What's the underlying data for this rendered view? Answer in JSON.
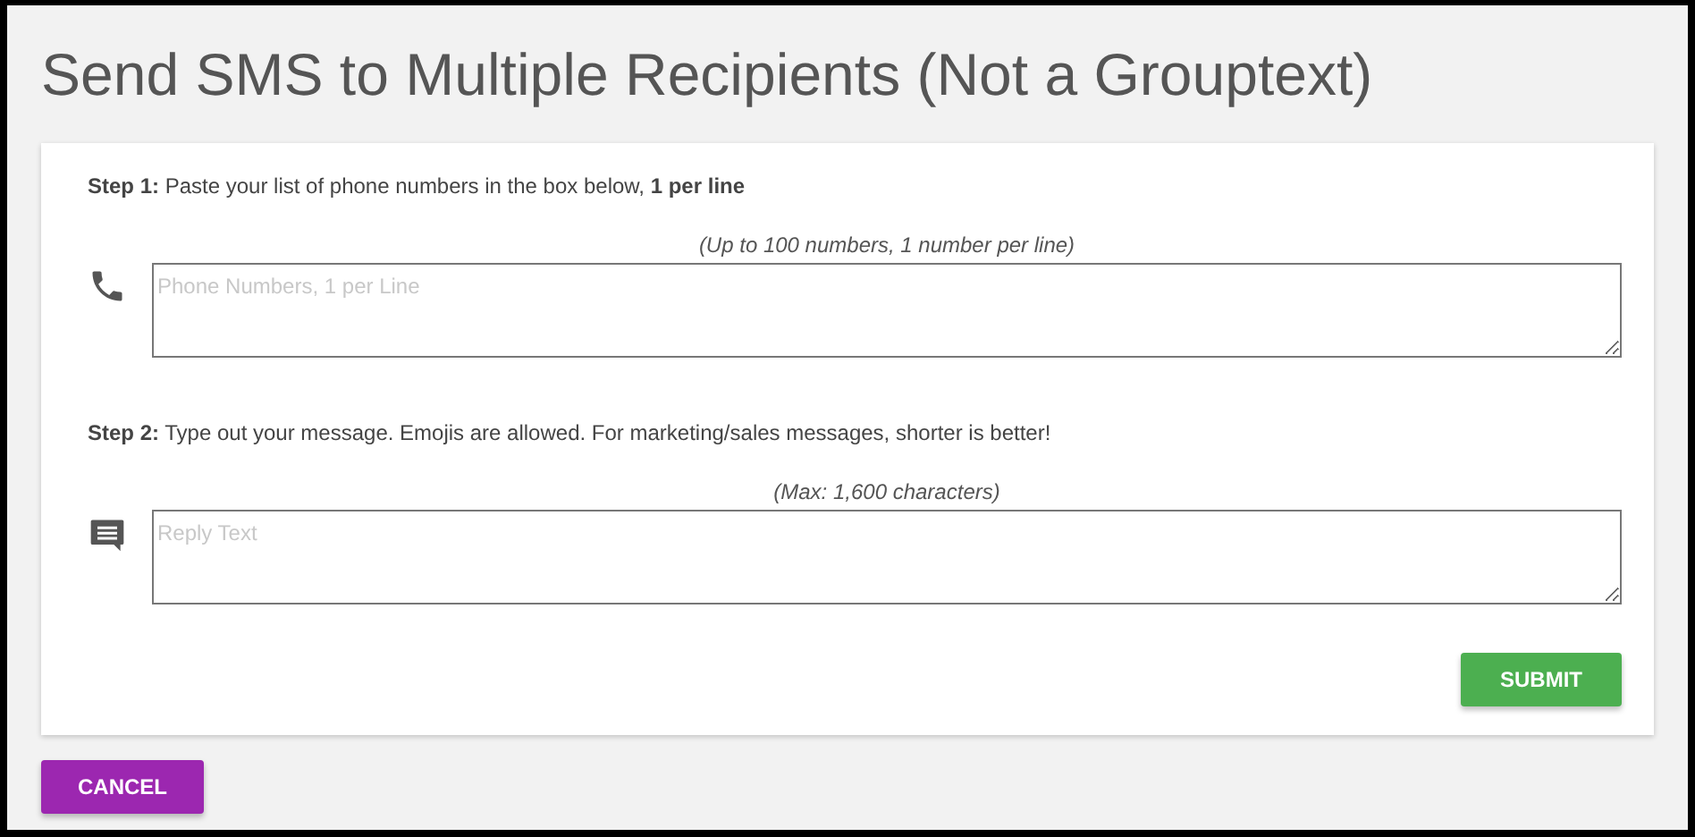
{
  "title": "Send SMS to Multiple Recipients (Not a Grouptext)",
  "steps": [
    {
      "instruction": "**Step 1:** Paste your list of phone numbers in the box below, **1 per line**",
      "hint": "(Up to 100 numbers, 1 number per line)",
      "kind": "phone",
      "placeholder": "Phone Numbers, 1 per Line"
    },
    {
      "instruction": "**Step 2:** Type out your message. Emojis are allowed. For marketing/sales messages, shorter is better!",
      "hint": "(Max: 1,600 characters)",
      "kind": "message",
      "placeholder": "Reply Text"
    }
  ],
  "submit_button": "SUBMIT",
  "cancel_button": "CANCEL"
}
